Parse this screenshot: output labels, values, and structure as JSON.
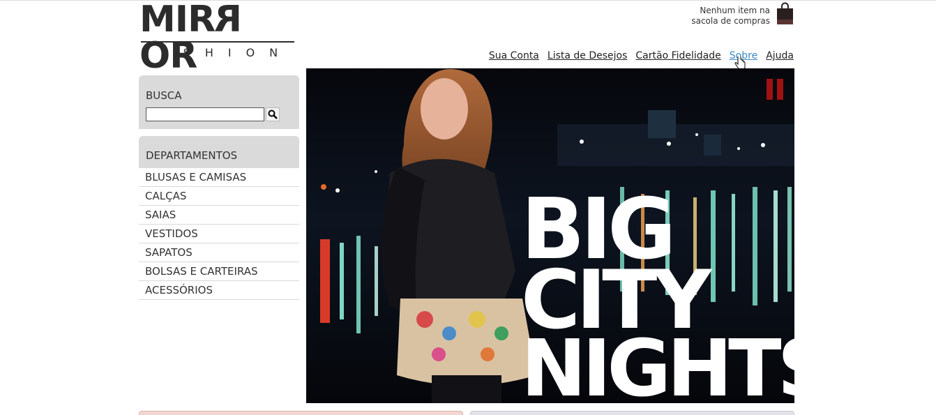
{
  "logo": {
    "word": "MIRROR",
    "sub": "FASHION"
  },
  "cart": {
    "line1": "Nenhum item na",
    "line2": "sacola de compras"
  },
  "nav": [
    {
      "label": "Sua Conta"
    },
    {
      "label": "Lista de Desejos"
    },
    {
      "label": "Cartão Fidelidade"
    },
    {
      "label": "Sobre"
    },
    {
      "label": "Ajuda"
    }
  ],
  "search": {
    "title": "BUSCA",
    "value": ""
  },
  "departments": {
    "title": "DEPARTAMENTOS",
    "items": [
      "BLUSAS E CAMISAS",
      "CALÇAS",
      "SAIAS",
      "VESTIDOS",
      "SAPATOS",
      "BOLSAS E CARTEIRAS",
      "ACESSÓRIOS"
    ]
  },
  "banner": {
    "line1": "BIG",
    "line2": "CITY",
    "line3": "NIGHTS"
  },
  "colors": {
    "pause": "#a01212",
    "link_hover": "#3a87c7",
    "sidebar_bg": "#dadada"
  }
}
